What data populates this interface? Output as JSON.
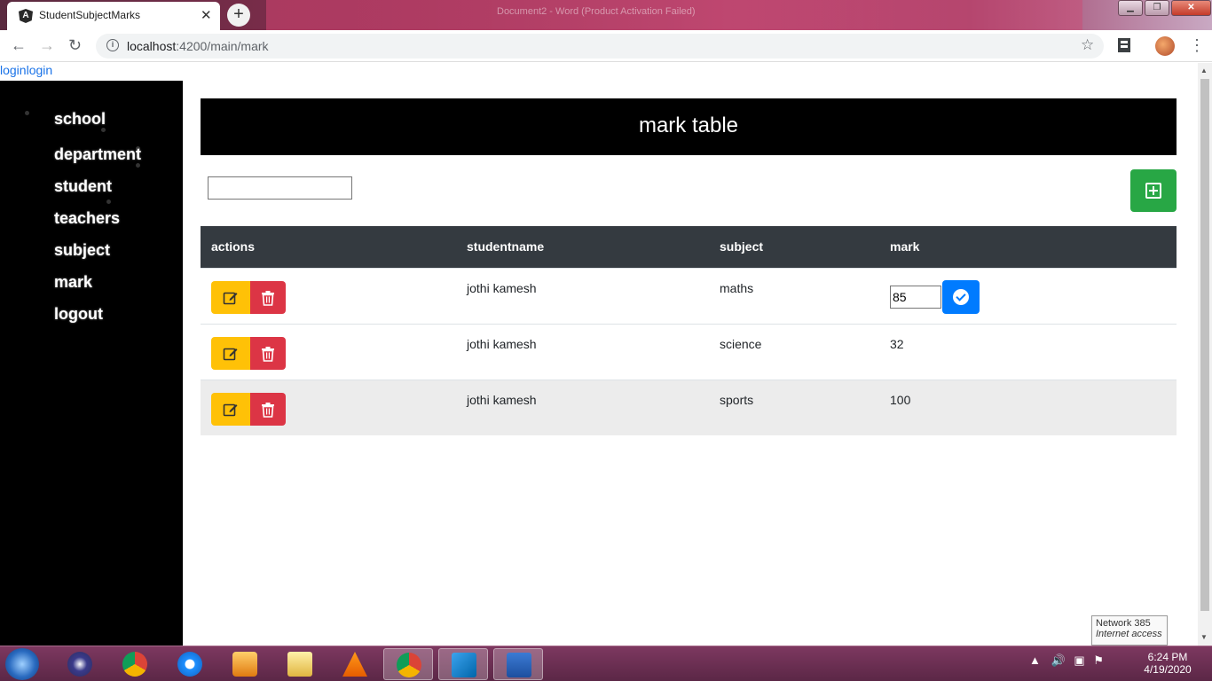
{
  "browser": {
    "tab_title": "StudentSubjectMarks",
    "tab_close": "✕",
    "new_tab": "+",
    "url_host": "localhost",
    "url_rest": ":4200/main/mark",
    "window_title": "Document2 - Word (Product Activation Failed)"
  },
  "page": {
    "login_link": "loginlogin",
    "nav": [
      {
        "label": "school"
      },
      {
        "label": "department"
      },
      {
        "label": "student"
      },
      {
        "label": "teachers"
      },
      {
        "label": "subject"
      },
      {
        "label": "mark"
      },
      {
        "label": "logout"
      }
    ],
    "header_title": "mark table",
    "search": {
      "value": "",
      "placeholder": ""
    },
    "table": {
      "columns": [
        "actions",
        "studentname",
        "subject",
        "mark"
      ],
      "rows": [
        {
          "studentname": "jothi kamesh",
          "subject": "maths",
          "mark": "85",
          "editing": true
        },
        {
          "studentname": "jothi kamesh",
          "subject": "science",
          "mark": "32",
          "editing": false
        },
        {
          "studentname": "jothi kamesh",
          "subject": "sports",
          "mark": "100",
          "editing": false
        }
      ]
    }
  },
  "tooltip": {
    "line1": "Network  385",
    "line2": "Internet access"
  },
  "taskbar": {
    "time": "6:24 PM",
    "date": "4/19/2020"
  },
  "colors": {
    "edit": "#ffc107",
    "delete": "#dc3545",
    "add": "#28a745",
    "confirm": "#007bff",
    "table_header": "#343a40",
    "link": "#1a73e8"
  }
}
